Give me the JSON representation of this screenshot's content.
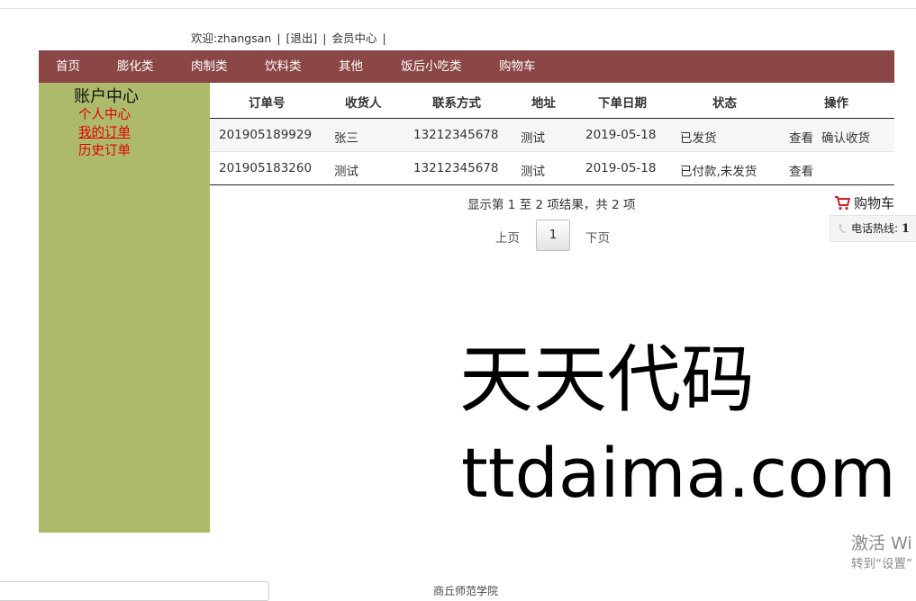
{
  "header": {
    "welcome": "欢迎:zhangsan",
    "logout": "[退出]",
    "member_center": "会员中心"
  },
  "nav": {
    "items": [
      "首页",
      "膨化类",
      "肉制类",
      "饮料类",
      "其他",
      "饭后小吃类",
      "购物车"
    ]
  },
  "sidebar": {
    "title": "账户中心",
    "items": [
      {
        "label": "个人中心"
      },
      {
        "label": "我的订单",
        "active": true
      },
      {
        "label": "历史订单"
      }
    ]
  },
  "orders": {
    "columns": [
      "订单号",
      "收货人",
      "联系方式",
      "地址",
      "下单日期",
      "状态",
      "操作"
    ],
    "rows": [
      {
        "id": "201905189929",
        "receiver": "张三",
        "phone": "13212345678",
        "address": "测试",
        "date": "2019-05-18",
        "status": "已发货",
        "actions": [
          "查看",
          "确认收货"
        ]
      },
      {
        "id": "201905183260",
        "receiver": "测试",
        "phone": "13212345678",
        "address": "测试",
        "date": "2019-05-18",
        "status": "已付款,未发货",
        "actions": [
          "查看"
        ]
      }
    ]
  },
  "pagination": {
    "info": "显示第 1 至 2 项结果，共 2 项",
    "prev": "上页",
    "current": "1",
    "next": "下页"
  },
  "float_cart": {
    "label": "购物车"
  },
  "hotline": {
    "label": "电话热线:",
    "value": "1"
  },
  "watermark": {
    "cn": "天天代码",
    "en": "ttdaima.com"
  },
  "system_notice": {
    "line1": "激活 Wi",
    "line2": "转到“设置”"
  },
  "footer_cut": {
    "text": "商丘师范学院"
  },
  "colors": {
    "nav": "#8b4646",
    "sidebar": "#aeba6b",
    "sidebar_link": "#e00000"
  }
}
